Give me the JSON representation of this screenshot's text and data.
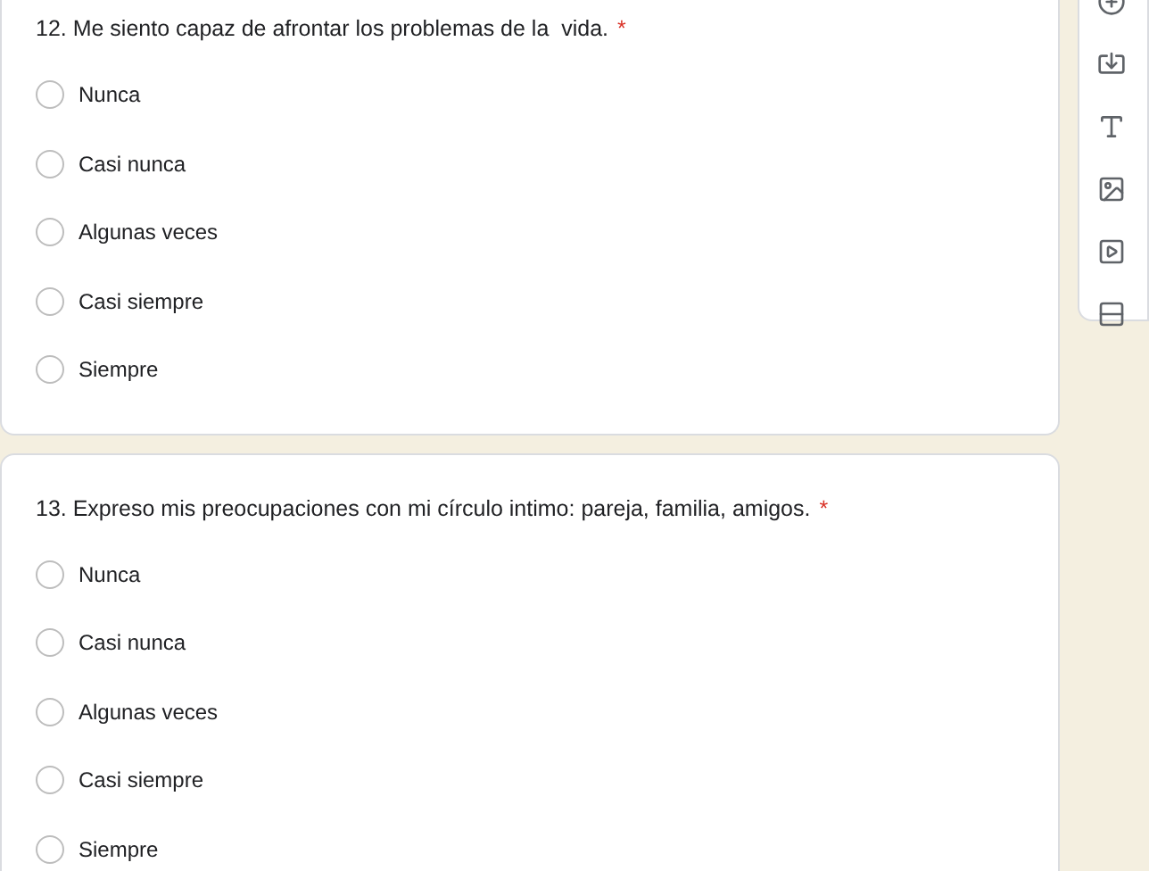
{
  "questions": [
    {
      "title": "12. Me siento capaz de afrontar los problemas de la  vida.",
      "required": true,
      "options": [
        {
          "label": "Nunca",
          "selected": false
        },
        {
          "label": "Casi nunca",
          "selected": false
        },
        {
          "label": "Algunas veces",
          "selected": false
        },
        {
          "label": "Casi siempre",
          "selected": false
        },
        {
          "label": "Siempre",
          "selected": false
        }
      ]
    },
    {
      "title": "13. Expreso mis preocupaciones con mi círculo intimo: pareja, familia, amigos.",
      "required": true,
      "options": [
        {
          "label": "Nunca",
          "selected": false
        },
        {
          "label": "Casi nunca",
          "selected": false
        },
        {
          "label": "Algunas veces",
          "selected": false
        },
        {
          "label": "Casi siempre",
          "selected": false
        },
        {
          "label": "Siempre",
          "selected": false
        }
      ]
    }
  ],
  "required_mark": "*"
}
